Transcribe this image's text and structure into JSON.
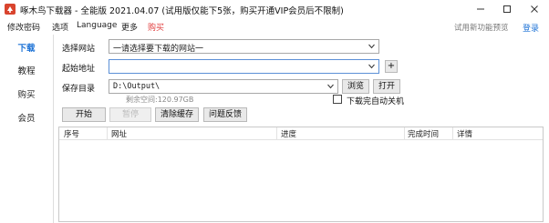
{
  "window": {
    "title": "啄木鸟下载器 - 全能版 2021.04.07 (试用版仅能下5张，购买开通VIP会员后不限制)"
  },
  "menu": {
    "items": [
      "修改密码",
      "选项",
      "Language",
      "更多"
    ],
    "buy": "购买",
    "trial_label": "试用新功能预览",
    "login": "登录"
  },
  "sidebar": {
    "items": [
      {
        "label": "下载"
      },
      {
        "label": "教程"
      },
      {
        "label": "购买"
      },
      {
        "label": "会员"
      }
    ]
  },
  "form": {
    "site_label": "选择网站",
    "site_value": "一请选择要下载的网站一",
    "url_label": "起始地址",
    "url_value": "",
    "add_symbol": "+",
    "dir_label": "保存目录",
    "dir_value": "D:\\Output\\",
    "browse_label": "浏览",
    "open_label": "打开",
    "free_space": "剩余空间:120.97GB",
    "shutdown_label": "下载完自动关机"
  },
  "actions": {
    "start": "开始",
    "pause": "暂停",
    "clear_cache": "清除缓存",
    "feedback": "问题反馈"
  },
  "table": {
    "columns": [
      "序号",
      "网址",
      "进度",
      "完成时间",
      "详情"
    ]
  },
  "colors": {
    "accent": "#1e73d6",
    "buy": "#e03c3c"
  }
}
